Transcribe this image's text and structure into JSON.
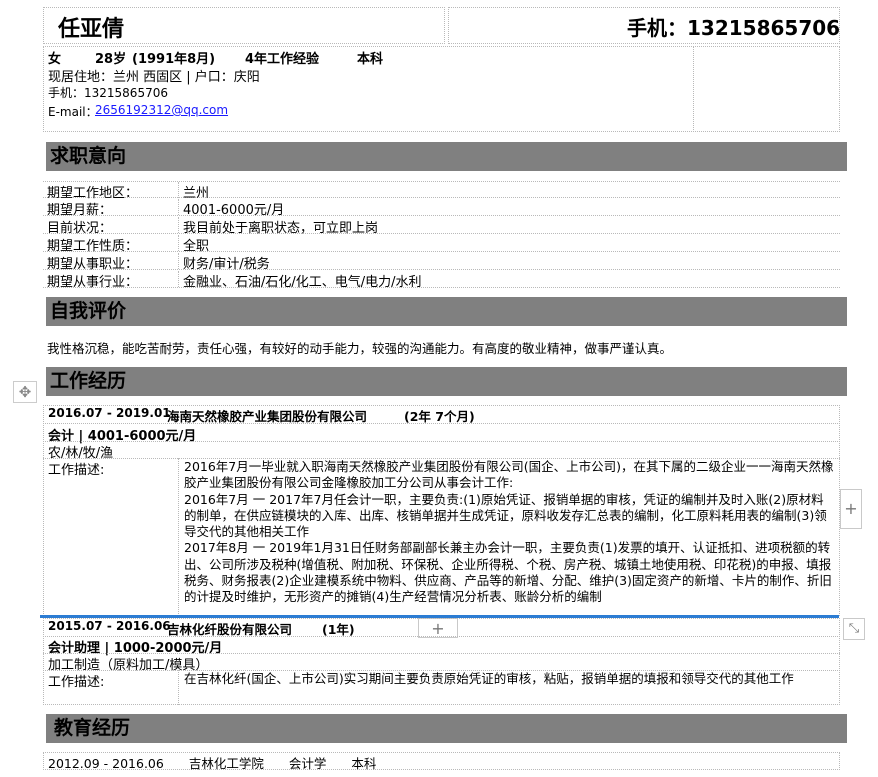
{
  "header": {
    "name": "任亚倩",
    "phone_label": "手机：13215865706",
    "gender": "女",
    "age": "28岁",
    "birth": "(1991年8月)",
    "experience": "4年工作经验",
    "degree": "本科",
    "residence": "现居住地：兰州 西固区 | 户口：庆阳",
    "mobile": "手机：13215865706",
    "email_label": "E-mail：",
    "email": "2656192312@qq.com"
  },
  "sections": {
    "intent": "求职意向",
    "self": "自我评价",
    "work": "工作经历",
    "edu": "教育经历"
  },
  "intent": [
    {
      "k": "期望工作地区：",
      "v": "兰州"
    },
    {
      "k": "期望月薪：",
      "v": "4001-6000元/月"
    },
    {
      "k": "目前状况：",
      "v": "我目前处于离职状态，可立即上岗"
    },
    {
      "k": "期望工作性质：",
      "v": "全职"
    },
    {
      "k": "期望从事职业：",
      "v": "财务/审计/税务"
    },
    {
      "k": "期望从事行业：",
      "v": "金融业、石油/石化/化工、电气/电力/水利"
    }
  ],
  "self_eval": "我性格沉稳，能吃苦耐劳，责任心强，有较好的动手能力，较强的沟通能力。有高度的敬业精神，做事严谨认真。",
  "jobs": [
    {
      "period": "2016.07 - 2019.01",
      "company": "海南天然橡胶产业集团股份有限公司",
      "duration": "(2年 7个月)",
      "title": "会计 | 4001-6000元/月",
      "industry": "农/林/牧/渔",
      "desc_label": "工作描述:",
      "desc": [
        "2016年7月一毕业就入职海南天然橡胶产业集团股份有限公司(国企、上市公司)，在其下属的二级企业一一海南天然橡胶产业集团股份有限公司金隆橡胶加工分公司从事会计工作:",
        "2016年7月 一 2017年7月任会计一职，主要负责:(1)原始凭证、报销单据的审核，凭证的编制并及时入账(2)原材料的制单，在供应链模块的入库、出库、核销单据并生成凭证，原料收发存汇总表的编制，化工原料耗用表的编制(3)领导交代的其他相关工作",
        "2017年8月 一 2019年1月31日任财务部副部长兼主办会计一职，主要负责(1)发票的填开、认证抵扣、进项税额的转出、公司所涉及税种(增值税、附加税、环保税、企业所得税、个税、房产税、城镇土地使用税、印花税)的申报、填报税务、财务报表(2)企业建模系统中物料、供应商、产品等的新增、分配、维护(3)固定资产的新增、卡片的制作、折旧的计提及时维护，无形资产的摊销(4)生产经营情况分析表、账龄分析的编制"
      ]
    },
    {
      "period": "2015.07 - 2016.06",
      "company": "吉林化纤股份有限公司",
      "duration": "(1年)",
      "title": "会计助理 | 1000-2000元/月",
      "industry": "加工制造（原料加工/模具）",
      "desc_label": "工作描述:",
      "desc": [
        "在吉林化纤(国企、上市公司)实习期间主要负责原始凭证的审核，粘贴，报销单据的填报和领导交代的其他工作"
      ]
    }
  ],
  "education": "2012.09 - 2016.06　　吉林化工学院　　会计学　　本科",
  "controls": {
    "move_icon": "✥",
    "plus": "+",
    "expand_icon": "⤡"
  }
}
